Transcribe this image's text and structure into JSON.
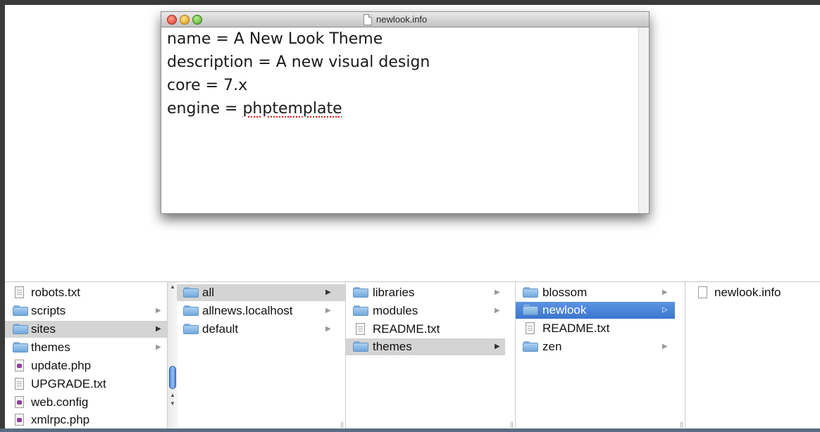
{
  "editor": {
    "title": "newlook.info",
    "lines": [
      "name = A New Look Theme",
      "description = A new visual design",
      "core = 7.x"
    ],
    "engine_prefix": "engine = ",
    "engine_value": "phptemplate"
  },
  "finder": {
    "col1": [
      {
        "label": "robots.txt",
        "icon": "file-icon"
      },
      {
        "label": "scripts",
        "icon": "folder-icon"
      },
      {
        "label": "sites",
        "icon": "folder-icon",
        "selected": true
      },
      {
        "label": "themes",
        "icon": "folder-icon"
      },
      {
        "label": "update.php",
        "icon": "php-icon"
      },
      {
        "label": "UPGRADE.txt",
        "icon": "file-icon"
      },
      {
        "label": "web.config",
        "icon": "php-icon"
      },
      {
        "label": "xmlrpc.php",
        "icon": "php-icon"
      }
    ],
    "col2": [
      {
        "label": "all",
        "icon": "folder-icon",
        "selected": true
      },
      {
        "label": "allnews.localhost",
        "icon": "folder-icon"
      },
      {
        "label": "default",
        "icon": "folder-icon"
      }
    ],
    "col3": [
      {
        "label": "libraries",
        "icon": "folder-icon"
      },
      {
        "label": "modules",
        "icon": "folder-icon"
      },
      {
        "label": "README.txt",
        "icon": "file-icon"
      },
      {
        "label": "themes",
        "icon": "folder-icon",
        "selected": true
      }
    ],
    "col4": [
      {
        "label": "blossom",
        "icon": "folder-icon"
      },
      {
        "label": "newlook",
        "icon": "folder-icon",
        "selected": true
      },
      {
        "label": "README.txt",
        "icon": "file-icon"
      },
      {
        "label": "zen",
        "icon": "folder-icon"
      }
    ],
    "col5": [
      {
        "label": "newlook.info",
        "icon": "blank-file-icon"
      }
    ]
  },
  "colors": {
    "selection_blue": "#3a76d0",
    "selection_gray": "#d4d4d4",
    "folder_blue": "#73a8d9"
  }
}
